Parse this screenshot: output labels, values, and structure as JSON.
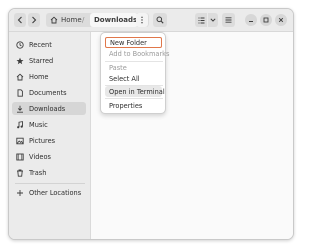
{
  "header": {
    "back_icon": "chevron-left-icon",
    "forward_icon": "chevron-right-icon",
    "breadcrumb": {
      "home_icon": "home-icon",
      "home_label": "Home",
      "separator": "/",
      "current_label": "Downloads"
    },
    "path_menu_icon": "vertical-ellipsis-icon",
    "search_icon": "search-icon",
    "view_icon": "list-view-icon",
    "view_dropdown_icon": "chevron-down-icon",
    "main_menu_icon": "hamburger-icon",
    "window_controls": [
      "minimize",
      "maximize",
      "close"
    ]
  },
  "sidebar": {
    "items": [
      {
        "label": "Recent",
        "icon": "clock-icon"
      },
      {
        "label": "Starred",
        "icon": "star-icon"
      },
      {
        "label": "Home",
        "icon": "home-icon"
      },
      {
        "label": "Documents",
        "icon": "document-icon"
      },
      {
        "label": "Downloads",
        "icon": "download-icon",
        "selected": true
      },
      {
        "label": "Music",
        "icon": "music-icon"
      },
      {
        "label": "Pictures",
        "icon": "picture-icon"
      },
      {
        "label": "Videos",
        "icon": "video-icon"
      },
      {
        "label": "Trash",
        "icon": "trash-icon"
      }
    ],
    "other": {
      "label": "Other Locations",
      "icon": "plus-icon"
    }
  },
  "context_menu": {
    "items": [
      {
        "label": "New Folder",
        "state": "focused"
      },
      {
        "label": "Add to Bookmarks",
        "state": "disabled"
      },
      {
        "label": "Paste",
        "state": "disabled"
      },
      {
        "label": "Select All",
        "state": "normal"
      },
      {
        "label": "Open in Terminal",
        "state": "hover"
      },
      {
        "label": "Properties",
        "state": "normal"
      }
    ]
  },
  "colors": {
    "header_bg": "#ebebeb",
    "sidebar_bg": "#ebebeb",
    "selected_bg": "#d6d6d6",
    "focus_ring": "#e0774a",
    "content_bg": "#fafafa"
  }
}
